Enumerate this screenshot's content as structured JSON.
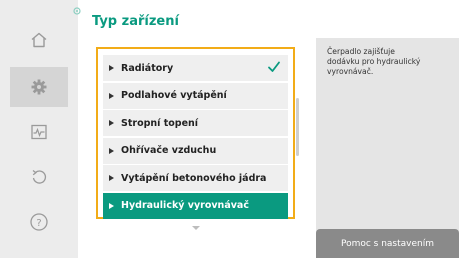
{
  "header": {
    "title": "Typ zařízení"
  },
  "sidebar": {
    "items": [
      {
        "icon": "home-icon"
      },
      {
        "icon": "gear-icon",
        "active": true
      },
      {
        "icon": "diagnostics-icon"
      },
      {
        "icon": "undo-icon"
      },
      {
        "icon": "help-icon"
      }
    ]
  },
  "list": {
    "items": [
      {
        "label": "Radiátory",
        "checked": true
      },
      {
        "label": "Podlahové vytápění"
      },
      {
        "label": "Stropní topení"
      },
      {
        "label": "Ohřívače vzduchu"
      },
      {
        "label": "Vytápění betonového jádra"
      },
      {
        "label": "Hydraulický vyrovnávač",
        "selected": true
      }
    ]
  },
  "help": {
    "text": "Čerpadlo zajišťuje\ndodávku pro hydraulický\nvyrovnávač.",
    "button_label": "Pomoc s nastavením"
  },
  "colors": {
    "accent": "#0a9a80",
    "focus": "#f2ac18",
    "sidebar": "#ececec"
  }
}
